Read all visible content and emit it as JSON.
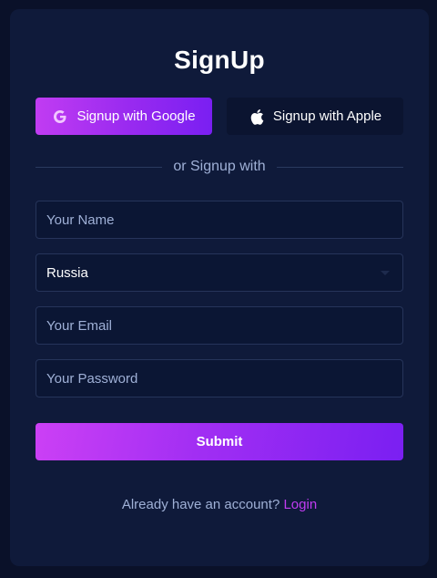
{
  "title": "SignUp",
  "social": {
    "google_label": "Signup with Google",
    "apple_label": "Signup with Apple",
    "google_icon": "google-icon",
    "apple_icon": "apple-icon"
  },
  "divider_text": "or Signup with",
  "form": {
    "name_placeholder": "Your Name",
    "country_value": "Russia",
    "email_placeholder": "Your Email",
    "password_placeholder": "Your Password",
    "submit_label": "Submit"
  },
  "footer": {
    "prompt": "Already have an account?",
    "login_label": "Login"
  },
  "colors": {
    "background": "#0a1129",
    "card": "#0f1a3a",
    "accent_start": "#c13cf2",
    "accent_end": "#7a1ff2",
    "muted_text": "#9fb0d6",
    "field_border": "#26345a"
  }
}
